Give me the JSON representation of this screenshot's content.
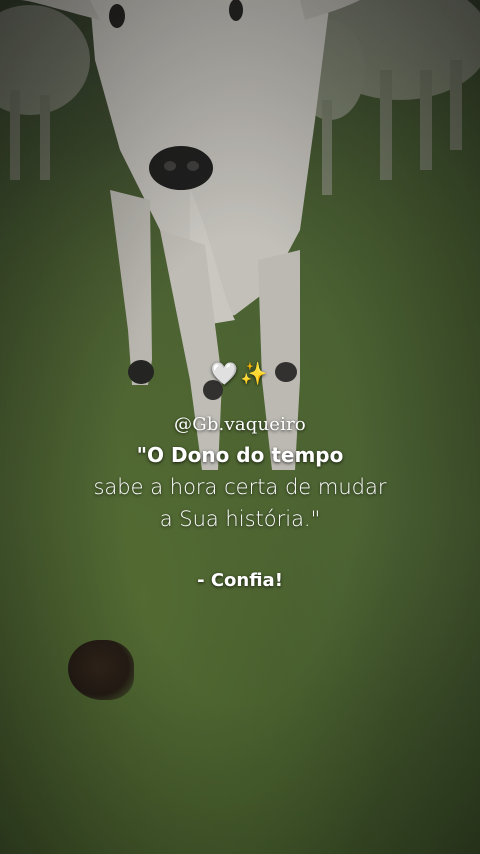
{
  "post": {
    "emoji": "🤍✨",
    "handle": "@Gb.vaqueiro",
    "quote_line1": "\"O Dono do tempo",
    "quote_line2": "sabe a hora certa de mudar",
    "quote_line3": "a Sua história.\"",
    "signature": "- Confia!"
  },
  "colors": {
    "grass": "#5b7540",
    "cattle": "#d9d6cf",
    "text": "#ffffff"
  }
}
